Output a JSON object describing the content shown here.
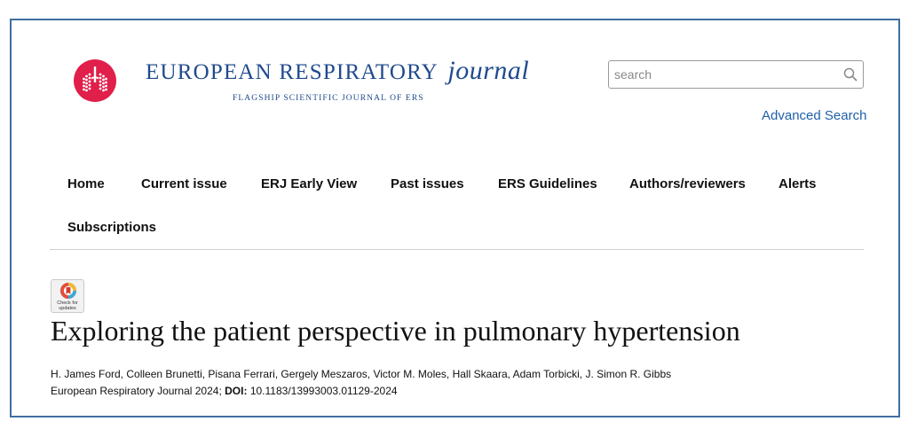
{
  "header": {
    "journal_name": "EUROPEAN RESPIRATORY",
    "journal_name_italic": "journal",
    "tagline": "FLAGSHIP SCIENTIFIC JOURNAL OF ERS",
    "logo_icon": "lungs-logo-icon",
    "brand_color": "#e01f4a",
    "title_color": "#1f4a8c"
  },
  "search": {
    "placeholder": "search",
    "value": "",
    "icon": "search-icon",
    "advanced_label": "Advanced Search"
  },
  "nav": {
    "items": [
      {
        "label": "Home"
      },
      {
        "label": "Current issue"
      },
      {
        "label": "ERJ Early View"
      },
      {
        "label": "Past issues"
      },
      {
        "label": "ERS Guidelines"
      },
      {
        "label": "Authors/reviewers"
      },
      {
        "label": "Alerts"
      },
      {
        "label": "Subscriptions"
      }
    ]
  },
  "crossmark": {
    "label": "Check for updates",
    "icon": "crossmark-icon"
  },
  "article": {
    "title": "Exploring the patient perspective in pulmonary hypertension",
    "authors": "H. James Ford, Colleen Brunetti, Pisana Ferrari, Gergely Meszaros, Victor M. Moles, Hall Skaara, Adam Torbicki, J. Simon R. Gibbs",
    "citation_source": "European Respiratory Journal 2024;",
    "doi_label": "DOI:",
    "doi_value": "10.1183/13993003.01129-2024"
  }
}
